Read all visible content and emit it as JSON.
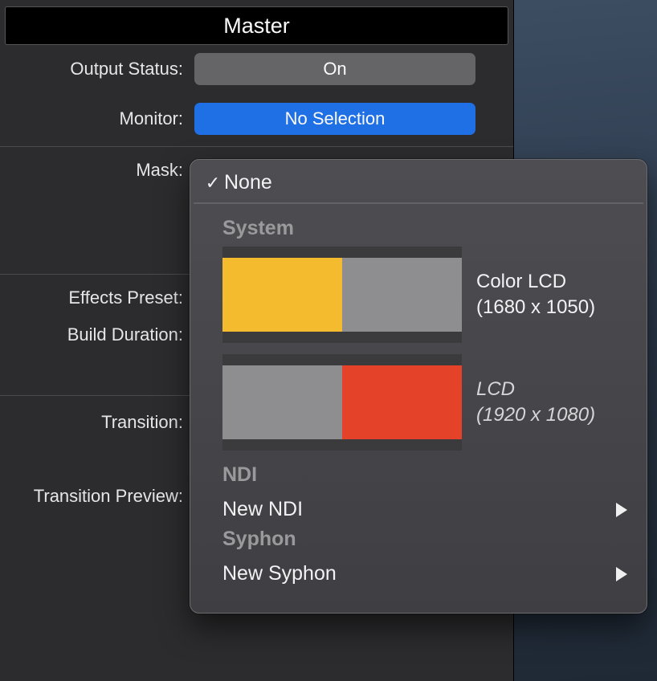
{
  "title": "Master",
  "rows": {
    "outputStatusLabel": "Output Status:",
    "outputStatusValue": "On",
    "monitorLabel": "Monitor:",
    "monitorValue": "No Selection",
    "maskLabel": "Mask:",
    "effectsPresetLabel": "Effects Preset:",
    "buildDurationLabel": "Build Duration:",
    "transitionLabel": "Transition:",
    "transitionPreviewLabel": "Transition Preview:"
  },
  "dropdown": {
    "noneLabel": "None",
    "systemHeading": "System",
    "monitors": [
      {
        "name": "Color LCD",
        "res": "(1680 x 1050)",
        "primaryColor": "yellow",
        "italic": false
      },
      {
        "name": "LCD",
        "res": "(1920 x 1080)",
        "primaryColor": "red",
        "italic": true
      }
    ],
    "ndiHeading": "NDI",
    "newNdi": "New NDI",
    "syphonHeading": "Syphon",
    "newSyphon": "New Syphon"
  }
}
